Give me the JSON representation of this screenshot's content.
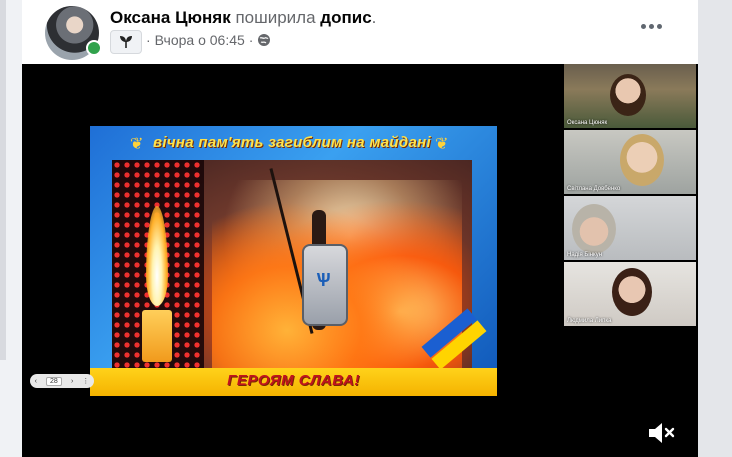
{
  "post": {
    "author": "Оксана Цюняк",
    "action": "поширила",
    "object": "допис",
    "punctuation": ".",
    "timestamp": "Вчора о 06:45",
    "separator": "·",
    "icons": {
      "group": "sprout-icon",
      "privacy": "globe-icon",
      "more": "more-icon",
      "mute": "muted-speaker-icon"
    }
  },
  "slide": {
    "title": "вічна пам'ять загиблим на майдані",
    "banner": "ГЕРОЯМ СЛАВА!"
  },
  "video": {
    "page_indicator": "28",
    "participants": [
      {
        "name": "Оксана Цюняк"
      },
      {
        "name": "Світлана Довбенко"
      },
      {
        "name": "Надія Бінкун"
      },
      {
        "name": "Людмила Липка"
      }
    ]
  },
  "colors": {
    "online": "#31a24c",
    "meta_text": "#65676b",
    "title_yellow": "#ffe34a",
    "banner_red": "#c1121f"
  }
}
